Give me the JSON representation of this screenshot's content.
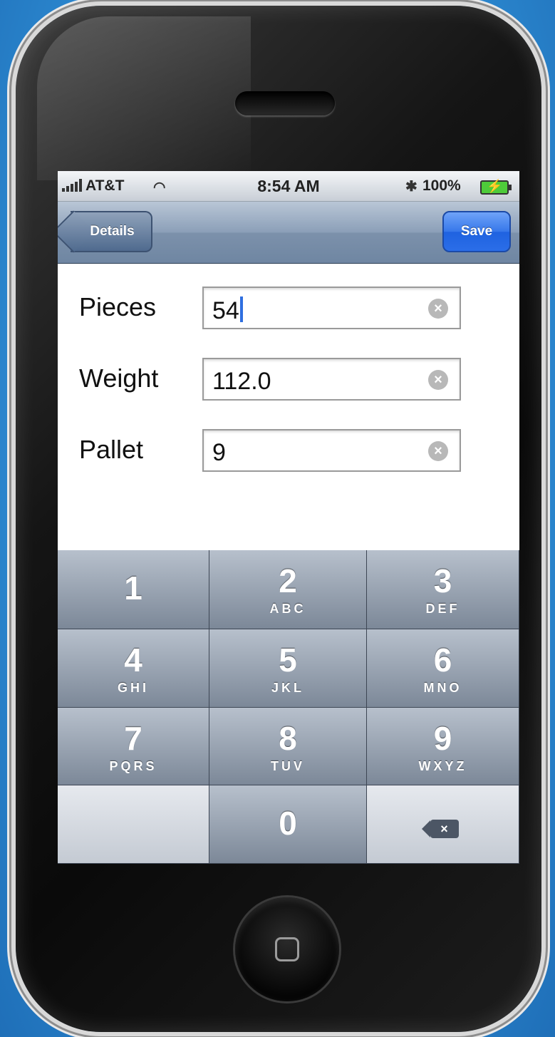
{
  "status_bar": {
    "carrier": "AT&T",
    "time": "8:54 AM",
    "battery": "100%"
  },
  "nav_bar": {
    "back_label": "Details",
    "save_label": "Save"
  },
  "form": {
    "fields": [
      {
        "label": "Pieces",
        "value": "54"
      },
      {
        "label": "Weight",
        "value": "112.0"
      },
      {
        "label": "Pallet",
        "value": "9"
      }
    ]
  },
  "keypad": {
    "keys": [
      {
        "digit": "1",
        "letters": ""
      },
      {
        "digit": "2",
        "letters": "ABC"
      },
      {
        "digit": "3",
        "letters": "DEF"
      },
      {
        "digit": "4",
        "letters": "GHI"
      },
      {
        "digit": "5",
        "letters": "JKL"
      },
      {
        "digit": "6",
        "letters": "MNO"
      },
      {
        "digit": "7",
        "letters": "PQRS"
      },
      {
        "digit": "8",
        "letters": "TUV"
      },
      {
        "digit": "9",
        "letters": "WXYZ"
      },
      {
        "digit": "0",
        "letters": ""
      }
    ]
  },
  "icons": {
    "signal": "signal-bars-icon",
    "wifi": "wifi-icon",
    "bluetooth": "bluetooth-icon",
    "battery": "battery-charging-icon",
    "clear": "clear-x-icon",
    "delete": "backspace-icon",
    "home": "home-button-icon"
  },
  "colors": {
    "background": "#2f8fd6",
    "nav_bar": "#8b9fb8",
    "save_button": "#2b6ee8",
    "caret": "#2f6fe0",
    "key_dark": "#7c8898"
  }
}
